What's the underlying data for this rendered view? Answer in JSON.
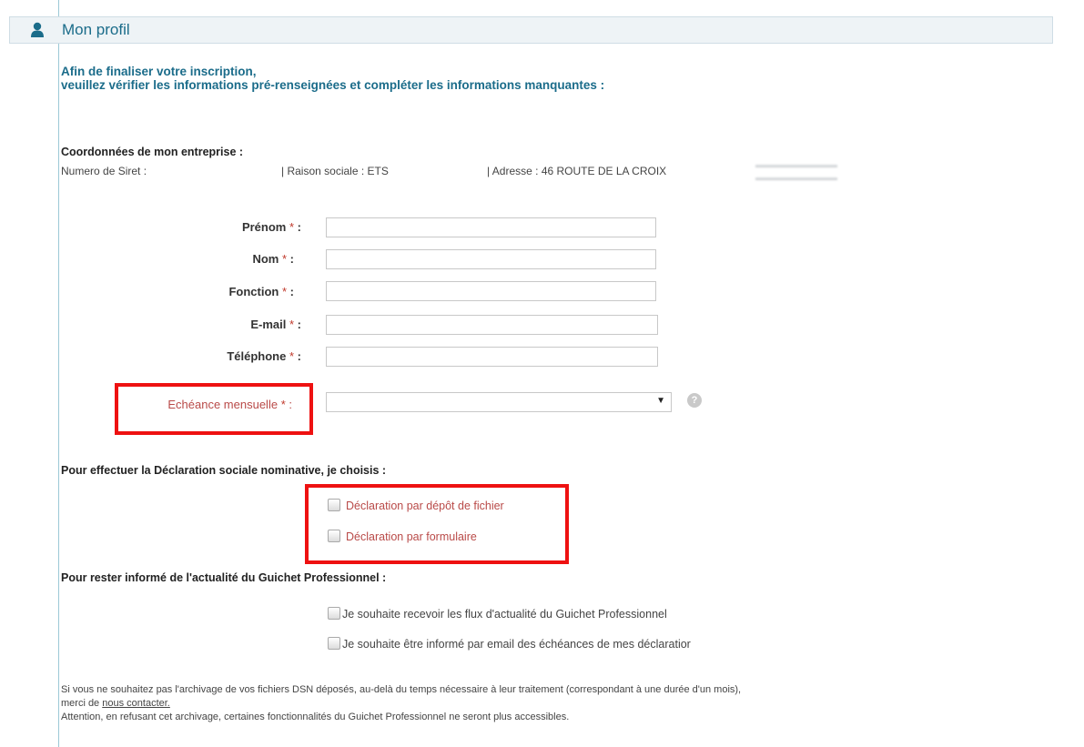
{
  "header": {
    "title": "Mon profil",
    "icon": "user-icon"
  },
  "intro": {
    "line1": "Afin de finaliser votre inscription,",
    "line2": "veuillez vérifier les informations pré-renseignées et compléter les informations manquantes :"
  },
  "company": {
    "title": "Coordonnées de mon entreprise :",
    "siret_label": "Numero de Siret :",
    "raison_sociale": "| Raison sociale : ETS",
    "adresse": "| Adresse : 46 ROUTE DE LA CROIX"
  },
  "form": {
    "star": "*",
    "fields": [
      {
        "label": "Prénom",
        "value": ""
      },
      {
        "label": "Nom",
        "value": ""
      },
      {
        "label": "Fonction",
        "value": ""
      },
      {
        "label": "E-mail",
        "value": ""
      },
      {
        "label": "Téléphone",
        "value": ""
      }
    ],
    "echeance": {
      "label": "Echéance mensuelle",
      "value": ""
    }
  },
  "dsn": {
    "title": "Pour effectuer la Déclaration sociale nominative, je choisis :",
    "options": [
      "Déclaration par dépôt de fichier",
      "Déclaration par formulaire"
    ]
  },
  "news": {
    "title": "Pour rester informé de l'actualité du Guichet Professionnel :",
    "options": [
      "Je souhaite recevoir les flux d'actualité du Guichet Professionnel",
      "Je souhaite être informé par email des échéances de mes déclaratior"
    ]
  },
  "footer": {
    "line1": "Si vous ne souhaitez pas l'archivage de vos fichiers DSN déposés, au-delà du temps nécessaire à leur traitement (correspondant à une durée d'un mois),",
    "line2_prefix": "merci de",
    "contact_link": "nous contacter.",
    "line3": "Attention, en refusant cet archivage, certaines fonctionnalités du Guichet Professionnel ne seront plus accessibles."
  },
  "colors": {
    "accent": "#1b6c8a",
    "required": "#c0392b",
    "highlight": "#ee1111"
  }
}
